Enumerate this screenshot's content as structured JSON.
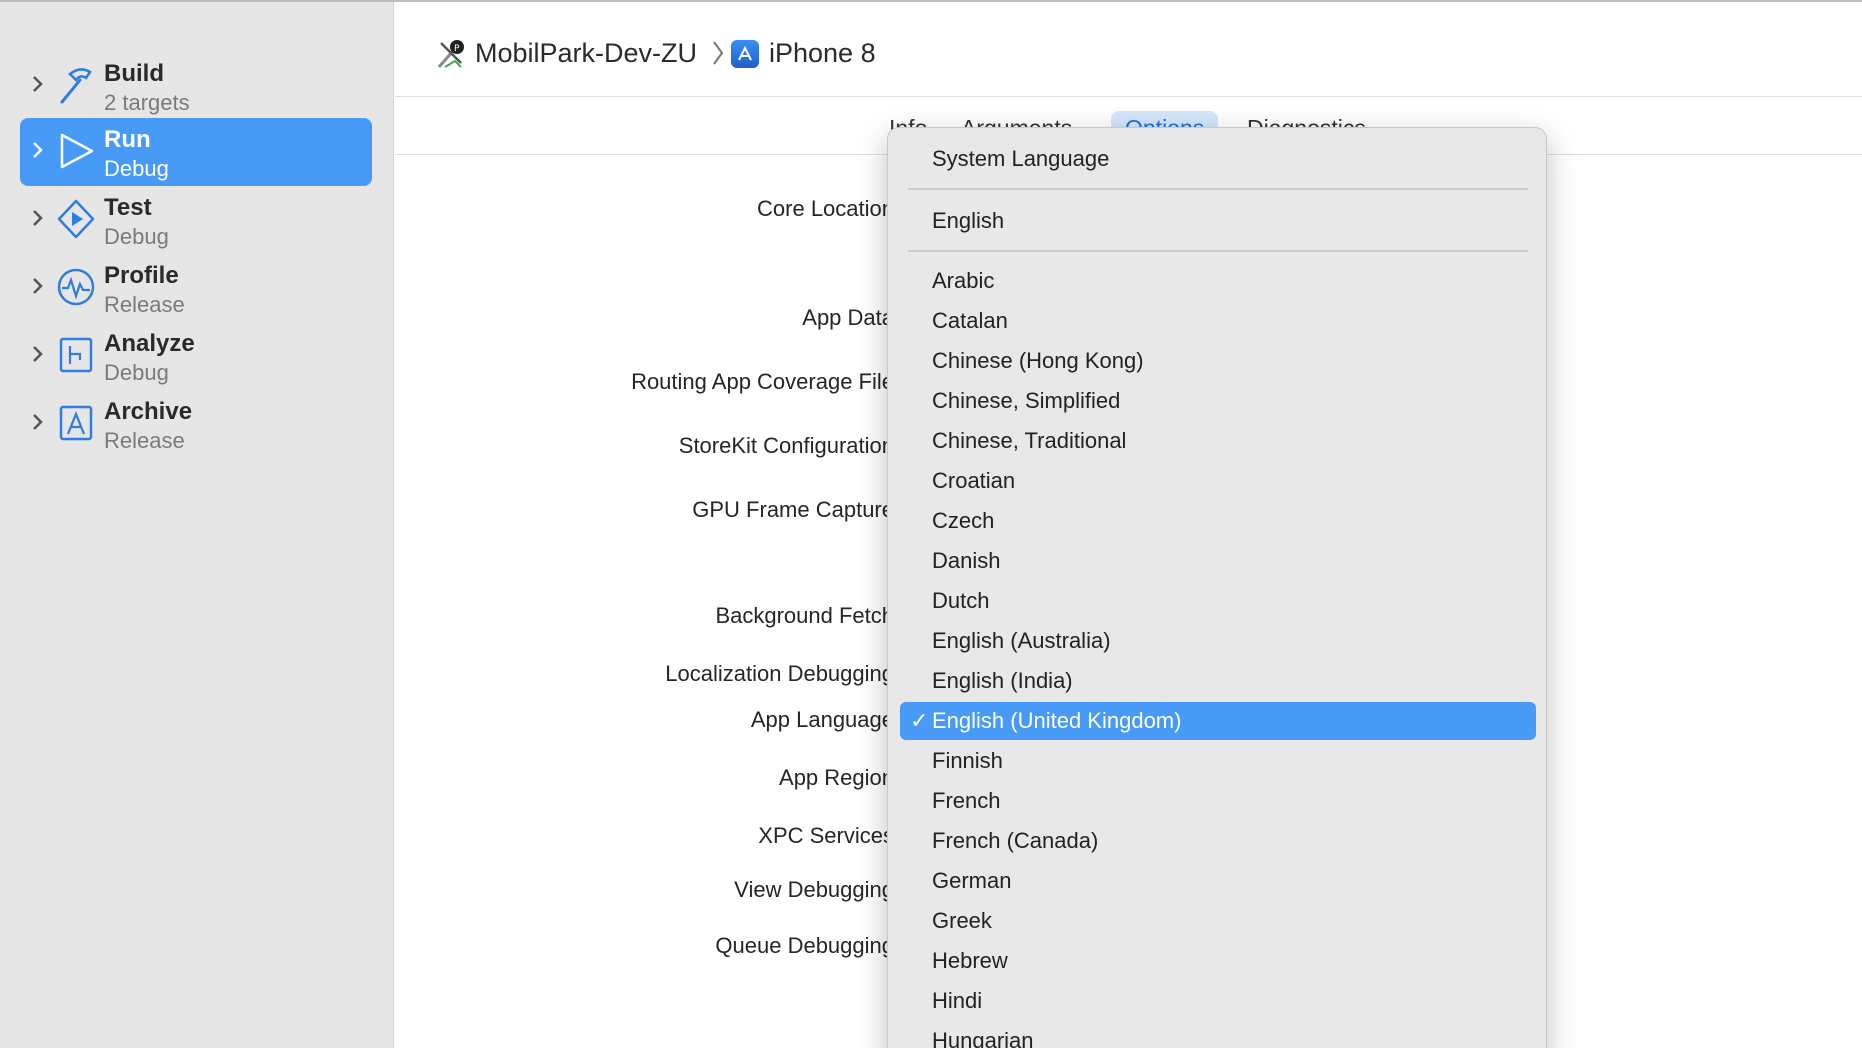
{
  "sidebar": {
    "items": [
      {
        "title": "Build",
        "subtitle": "2 targets",
        "icon": "hammer-icon"
      },
      {
        "title": "Run",
        "subtitle": "Debug",
        "icon": "play-icon"
      },
      {
        "title": "Test",
        "subtitle": "Debug",
        "icon": "test-diamond-icon"
      },
      {
        "title": "Profile",
        "subtitle": "Release",
        "icon": "profile-waveform-icon"
      },
      {
        "title": "Analyze",
        "subtitle": "Debug",
        "icon": "analyze-icon"
      },
      {
        "title": "Archive",
        "subtitle": "Release",
        "icon": "archive-icon"
      }
    ],
    "selected_index": 1
  },
  "header": {
    "scheme": "MobilPark-Dev-ZU",
    "destination": "iPhone 8"
  },
  "tabs": [
    {
      "label": "Info"
    },
    {
      "label": "Arguments"
    },
    {
      "label": "Options"
    },
    {
      "label": "Diagnostics"
    }
  ],
  "active_tab": "Options",
  "form_labels": [
    "Core Location",
    "App Data",
    "Routing App Coverage File",
    "StoreKit Configuration",
    "GPU Frame Capture",
    "Background Fetch",
    "Localization Debugging",
    "App Language",
    "App Region",
    "XPC Services",
    "View Debugging",
    "Queue Debugging"
  ],
  "language_menu": {
    "top_items": [
      "System Language",
      "English"
    ],
    "languages": [
      "Arabic",
      "Catalan",
      "Chinese (Hong Kong)",
      "Chinese, Simplified",
      "Chinese, Traditional",
      "Croatian",
      "Czech",
      "Danish",
      "Dutch",
      "English (Australia)",
      "English (India)",
      "English (United Kingdom)",
      "Finnish",
      "French",
      "French (Canada)",
      "German",
      "Greek",
      "Hebrew",
      "Hindi",
      "Hungarian"
    ],
    "selected": "English (United Kingdom)",
    "check_mark": "✓"
  },
  "colors": {
    "accent": "#479bf7",
    "sidebar_bg": "#e6e6e6",
    "menu_bg": "#e8e8e8"
  }
}
